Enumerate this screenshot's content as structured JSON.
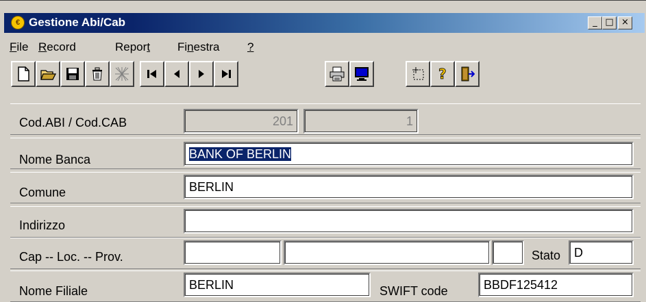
{
  "window": {
    "title": "Gestione Abi/Cab",
    "app_icon": "app-logo-icon",
    "controls": {
      "minimize": "_",
      "maximize": "□",
      "close": "×"
    }
  },
  "menu": [
    {
      "label": "File"
    },
    {
      "label": "Record"
    },
    {
      "label": "Report"
    },
    {
      "label": "Finestra"
    },
    {
      "label": "?"
    }
  ],
  "toolbar": [
    {
      "icon": "new-document-icon"
    },
    {
      "icon": "open-folder-icon"
    },
    {
      "icon": "save-disk-icon"
    },
    {
      "icon": "delete-trash-icon"
    },
    {
      "icon": "cancel-hatch-icon"
    },
    {
      "icon": "first-record-icon"
    },
    {
      "icon": "previous-record-icon"
    },
    {
      "icon": "next-record-icon"
    },
    {
      "icon": "last-record-icon"
    },
    {
      "icon": "print-icon"
    },
    {
      "icon": "preview-monitor-icon"
    },
    {
      "icon": "select-area-icon"
    },
    {
      "icon": "help-question-icon"
    },
    {
      "icon": "exit-door-icon"
    }
  ],
  "form": {
    "abi_cab_label": "Cod.ABI / Cod.CAB",
    "abi_value": "201",
    "cab_value": "1",
    "nome_banca_label": "Nome Banca",
    "nome_banca_value": "BANK OF BERLIN",
    "comune_label": "Comune",
    "comune_value": "BERLIN",
    "indirizzo_label": "Indirizzo",
    "indirizzo_value": "",
    "cap_label": "Cap -- Loc. -- Prov.",
    "cap_value": "",
    "loc_value": "",
    "prov_value": "",
    "stato_label": "Stato",
    "stato_value": "D",
    "filiale_label": "Nome Filiale",
    "filiale_value": "BERLIN",
    "swift_label": "SWIFT code",
    "swift_value": "BBDF125412"
  }
}
